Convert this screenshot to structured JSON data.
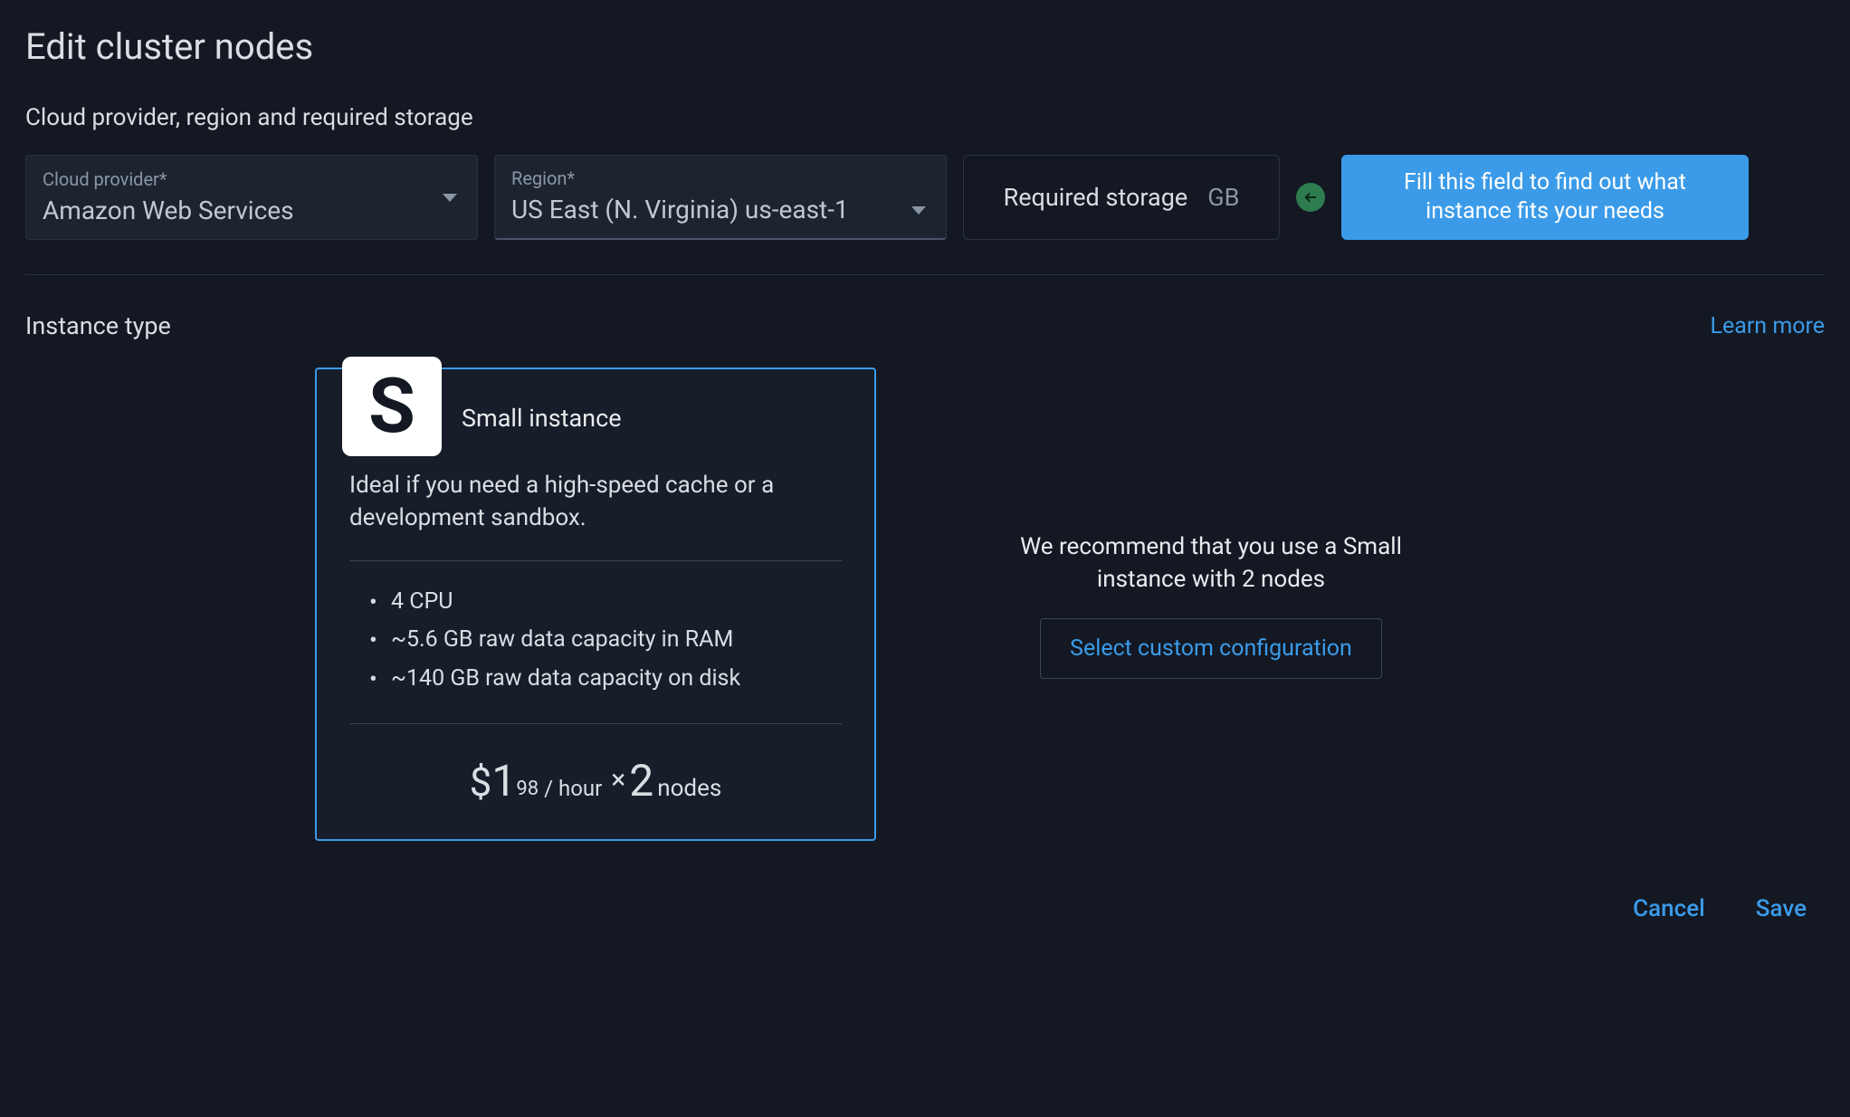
{
  "page_title": "Edit cluster nodes",
  "subtitle": "Cloud provider, region and required storage",
  "cloud_provider": {
    "label": "Cloud provider*",
    "value": "Amazon Web Services"
  },
  "region": {
    "label": "Region*",
    "value": "US East (N. Virginia) us-east-1"
  },
  "storage": {
    "label": "Required storage",
    "unit": "GB"
  },
  "tip": "Fill this field to find out what instance fits your needs",
  "instance_section": {
    "label": "Instance type",
    "learn_more": "Learn more"
  },
  "instance_card": {
    "badge_letter": "S",
    "name": "Small instance",
    "description": "Ideal if you need a high-speed cache or a development sandbox.",
    "specs": [
      "4 CPU",
      "~5.6 GB raw data capacity in RAM",
      "~140 GB raw data capacity on disk"
    ],
    "price": {
      "currency": "$",
      "int": "1",
      "cents": "98",
      "per": "/ hour",
      "mult": "×",
      "nodes_num": "2",
      "nodes_label": "nodes"
    }
  },
  "recommendation": {
    "text": "We recommend that you use a Small instance with 2 nodes",
    "button": "Select custom configuration"
  },
  "footer": {
    "cancel": "Cancel",
    "save": "Save"
  }
}
